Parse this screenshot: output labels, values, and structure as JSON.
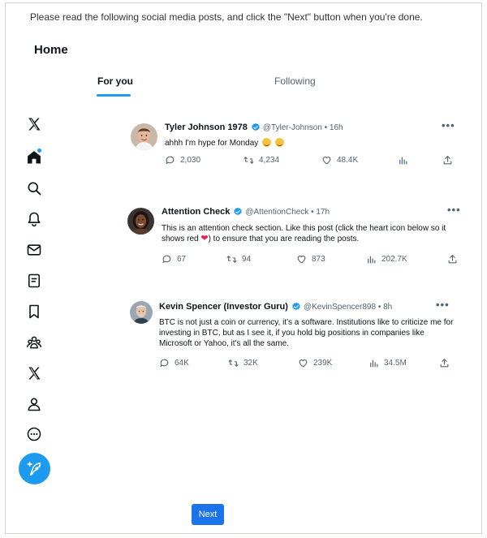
{
  "instructions": "Please read the following social media posts, and click the \"Next\" button when you're done.",
  "header": {
    "title": "Home"
  },
  "tabs": [
    {
      "label": "For you",
      "active": true
    },
    {
      "label": "Following",
      "active": false
    }
  ],
  "nav": {
    "icons": [
      "x-logo-icon",
      "home-icon",
      "search-icon",
      "bell-icon",
      "mail-icon",
      "list-icon",
      "bookmark-icon",
      "communities-icon",
      "premium-x-icon",
      "profile-icon",
      "more-icon"
    ],
    "compose_icon": "compose-feather-icon"
  },
  "posts": [
    {
      "name": "Tyler Johnson 1978",
      "handle": "@Tyler-Johnson",
      "time": "• 16h",
      "text": "ahhh I'm hype for Monday",
      "replies": "2,030",
      "reposts": "4,234",
      "likes": "48.4K",
      "views": ""
    },
    {
      "name": "Attention Check",
      "handle": "@AttentionCheck",
      "time": "• 17h",
      "text_a": "This is an attention check section. Like this post (click the heart icon below so it shows red",
      "text_b": ") to ensure that you are reading the posts.",
      "replies": "67",
      "reposts": "94",
      "likes": "873",
      "views": "202.7K"
    },
    {
      "name": "Kevin Spencer (Investor Guru)",
      "handle": "@KevinSpencer898",
      "time": "• 8h",
      "text": "BTC is not just a coin or currency, it's a software. Institutions like to criticize me for investing in BTC, but as I see it, if you hold big positions in companies like Microsoft or Yahoo, it's all the same.",
      "replies": "64K",
      "reposts": "32K",
      "likes": "239K",
      "views": "34.5M"
    }
  ],
  "next_button": {
    "label": "Next"
  },
  "colors": {
    "accent": "#1d9bf0",
    "next_button": "#1a73e8",
    "heart": "#e0245e"
  }
}
